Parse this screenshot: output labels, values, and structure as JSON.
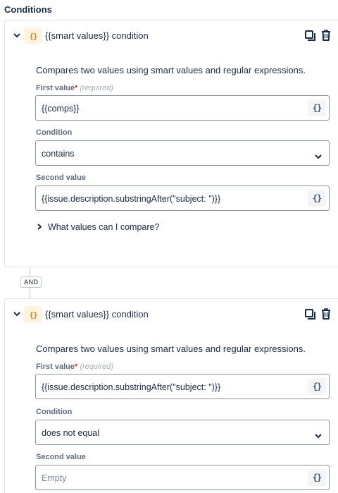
{
  "section": {
    "title": "Conditions"
  },
  "connector": {
    "label": "AND"
  },
  "conditions": [
    {
      "title": "{{smart values}} condition",
      "description": "Compares two values using smart values and regular expressions.",
      "first_value": {
        "label": "First value",
        "required_mark": "*",
        "required_text": "(required)",
        "value": "{{comps}}"
      },
      "condition": {
        "label": "Condition",
        "value": "contains"
      },
      "second_value": {
        "label": "Second value",
        "value": "{{issue.description.substringAfter(\"subject: \")}}"
      },
      "expander": "What values can I compare?"
    },
    {
      "title": "{{smart values}} condition",
      "description": "Compares two values using smart values and regular expressions.",
      "first_value": {
        "label": "First value",
        "required_mark": "*",
        "required_text": "(required)",
        "value": "{{issue.description.substringAfter(\"subject: \")}}"
      },
      "condition": {
        "label": "Condition",
        "value": "does not equal"
      },
      "second_value": {
        "label": "Second value",
        "placeholder": "Empty"
      }
    }
  ],
  "icons": {
    "brace": "{}",
    "smart_value_button": "{}",
    "collapse": "chevron-down-icon",
    "copy": "copy-icon",
    "delete": "trash-icon",
    "expand": "chevron-right-icon"
  },
  "colors": {
    "accent_badge_bg": "#fff4e0",
    "accent_badge_fg": "#e2801b",
    "required": "#de350b"
  }
}
